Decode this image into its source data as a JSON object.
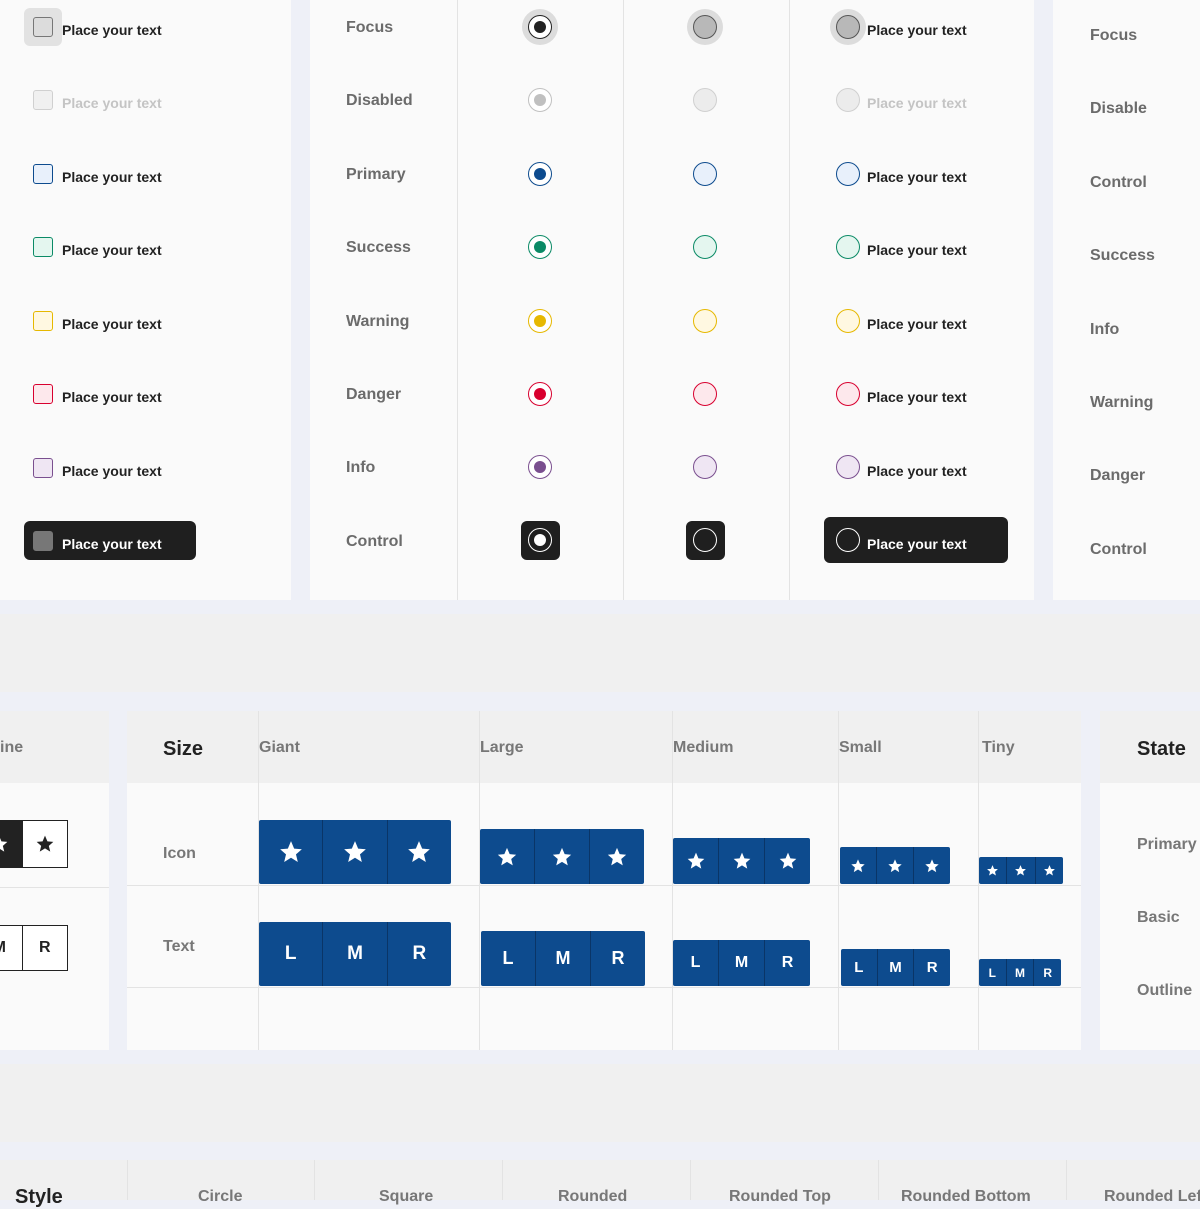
{
  "checkbox_column": {
    "item_label": "Place your text",
    "colors": {
      "focus": {
        "fill": "#dcdcdc",
        "border": "#777777"
      },
      "disabled": {
        "fill": "#f0f0f0",
        "border": "#d0d0d0"
      },
      "primary": {
        "fill": "#e8f0fb",
        "border": "#0d4b8e"
      },
      "success": {
        "fill": "#e4f6ef",
        "border": "#0b8a66"
      },
      "warning": {
        "fill": "#fff8e1",
        "border": "#e6b800"
      },
      "danger": {
        "fill": "#fde8ec",
        "border": "#d8002f"
      },
      "info": {
        "fill": "#efe6f3",
        "border": "#7a4f8f"
      },
      "control": {
        "fill": "#777777",
        "border": "#777777"
      }
    }
  },
  "radio_table": {
    "rows": [
      "Focus",
      "Disabled",
      "Primary",
      "Success",
      "Warning",
      "Danger",
      "Info",
      "Control"
    ],
    "item_label": "Place your text",
    "colors": {
      "focus": "#222222",
      "disabled": "#c0c0c0",
      "primary": "#0d4b8e",
      "success": "#0b8a66",
      "warning": "#e6b800",
      "danger": "#d8002f",
      "info": "#7a4f8f",
      "control": "#ffffff"
    }
  },
  "right_state_list": {
    "rows": [
      "Focus",
      "Disable",
      "Control",
      "Success",
      "Info",
      "Warning",
      "Danger",
      "Control"
    ]
  },
  "button_group_table": {
    "left_partial_header": "ine",
    "size_header": "Size",
    "columns": [
      "Giant",
      "Large",
      "Medium",
      "Small",
      "Tiny"
    ],
    "row_labels": [
      "Icon",
      "Text"
    ],
    "text_segments": [
      "L",
      "M",
      "R"
    ],
    "accent_color": "#0d4b8e",
    "icon_name": "star-icon"
  },
  "state_panel": {
    "header": "State",
    "items": [
      "Primary",
      "Basic",
      "Outline"
    ]
  },
  "style_table": {
    "header": "Style",
    "columns": [
      "Circle",
      "Square",
      "Rounded",
      "Rounded Top",
      "Rounded Bottom",
      "Rounded Left"
    ]
  }
}
